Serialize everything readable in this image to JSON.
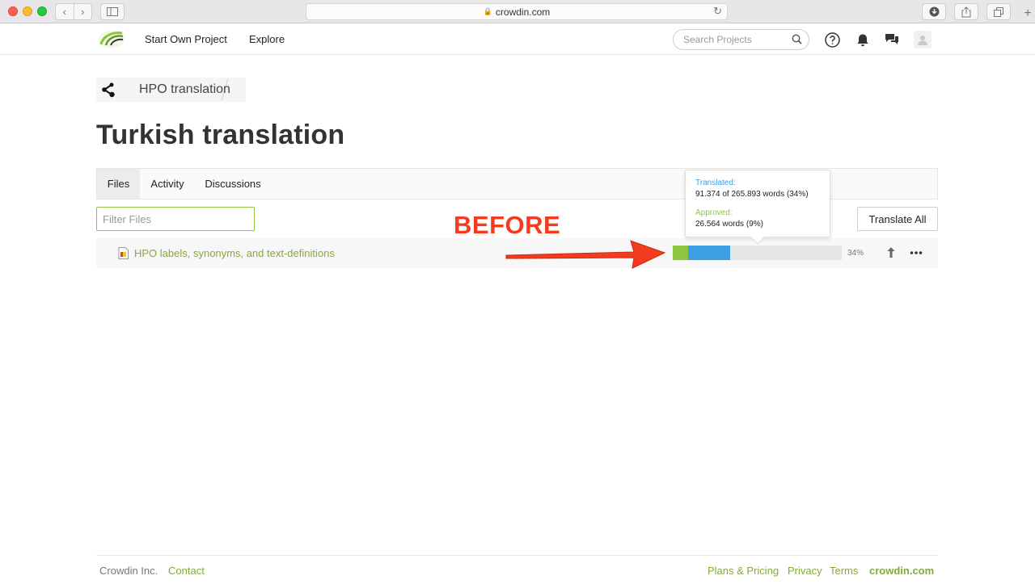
{
  "browser": {
    "url": "crowdin.com",
    "nav_back": "‹",
    "nav_forward": "›"
  },
  "header": {
    "nav_start": "Start Own Project",
    "nav_explore": "Explore",
    "search_placeholder": "Search Projects"
  },
  "breadcrumb": {
    "project": "HPO translation"
  },
  "page": {
    "title": "Turkish translation"
  },
  "tabs": [
    {
      "label": "Files",
      "active": true
    },
    {
      "label": "Activity",
      "active": false
    },
    {
      "label": "Discussions",
      "active": false
    }
  ],
  "filter": {
    "placeholder": "Filter Files"
  },
  "actions": {
    "translate_all": "Translate All"
  },
  "file": {
    "name": "HPO labels, synonyms, and text-definitions",
    "approved_fraction": 0.09,
    "translated_fraction": 0.34,
    "percent_label": "34%"
  },
  "tooltip": {
    "translated_label": "Translated:",
    "translated_value": "91.374 of 265.893 words (34%)",
    "approved_label": "Approved:",
    "approved_value": "26.564 words (9%)"
  },
  "annotation": {
    "label": "BEFORE"
  },
  "footer": {
    "company": "Crowdin Inc.",
    "contact": "Contact",
    "plans": "Plans & Pricing",
    "privacy": "Privacy",
    "terms": "Terms",
    "brand": "crowdin.com"
  },
  "colors": {
    "accent_green": "#8cc63f",
    "link_green": "#86aa3a",
    "translated_blue": "#3d9fe3",
    "annotation_red": "#f23b1f"
  },
  "icons": {
    "logo": "crowdin-logo",
    "search": "search-icon",
    "help": "help-icon",
    "bell": "bell-icon",
    "chat": "chat-icon",
    "avatar": "user-icon",
    "share": "share-icon",
    "upload": "upload-icon",
    "more": "more-icon"
  }
}
